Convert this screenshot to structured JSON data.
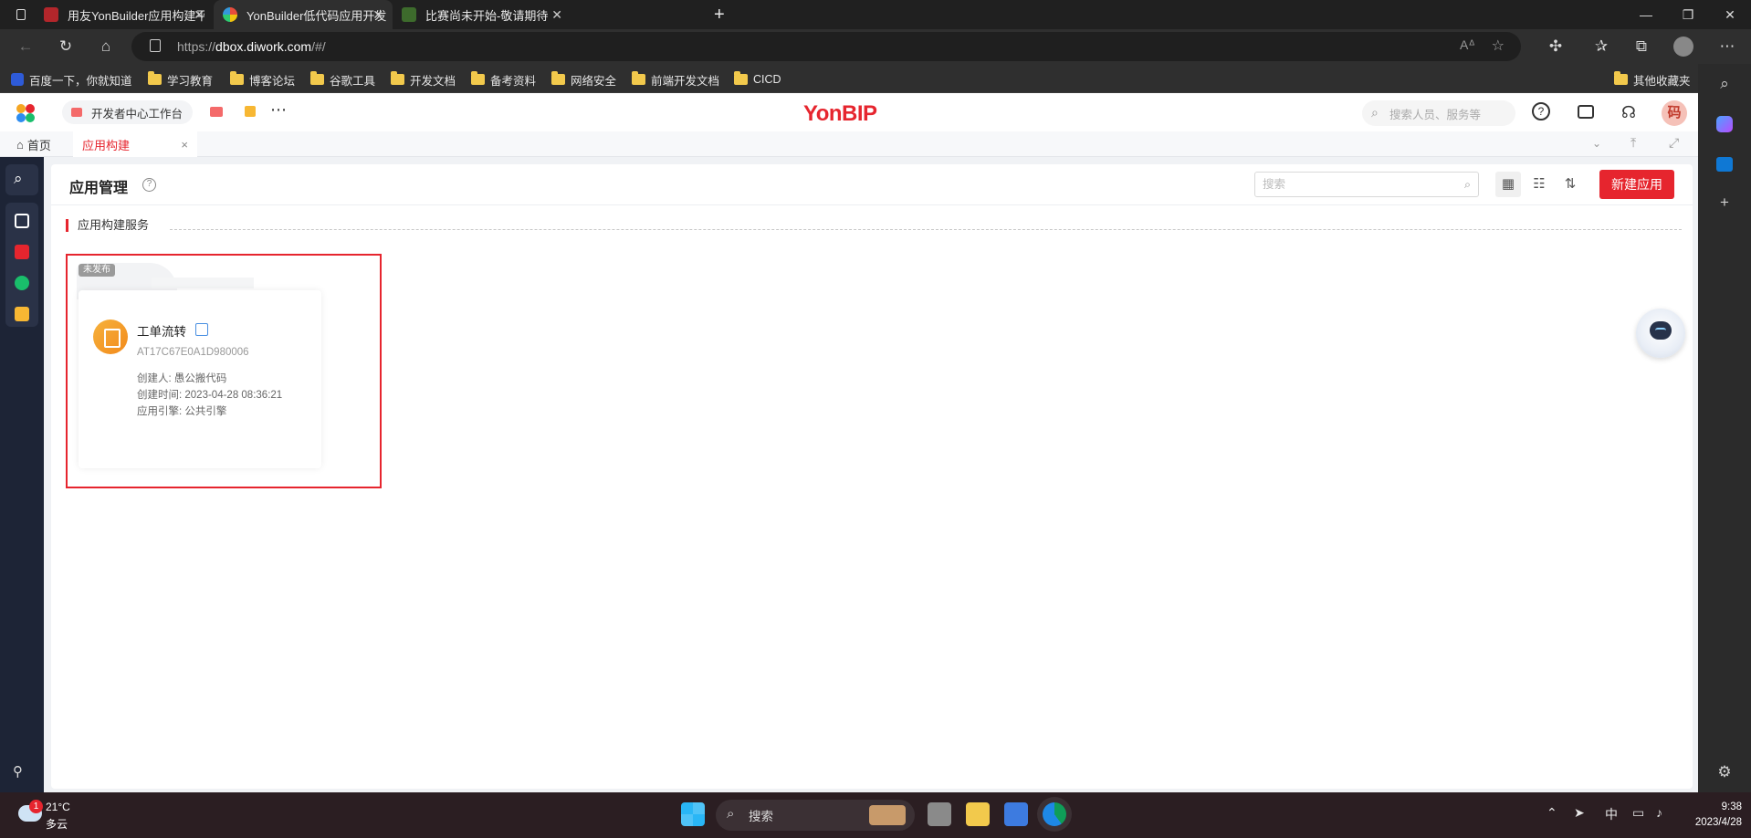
{
  "browser": {
    "tabs": [
      {
        "title": "用友YonBuilder应用构建平台-可",
        "active": false
      },
      {
        "title": "YonBuilder低代码应用开发",
        "active": true
      },
      {
        "title": "比赛尚未开始-敬请期待",
        "active": false
      }
    ],
    "url_prefix": "https://",
    "url_host": "dbox.diwork.com",
    "url_path": "/#/",
    "new_tab": "+"
  },
  "bookmarks": {
    "items": [
      "百度一下，你就知道",
      "学习教育",
      "博客论坛",
      "谷歌工具",
      "开发文档",
      "备考资料",
      "网络安全",
      "前端开发文档",
      "CICD"
    ],
    "other": "其他收藏夹"
  },
  "app_header": {
    "workbench_label": "开发者中心工作台",
    "brand": "YonBIP",
    "search_placeholder": "搜索人员、服务等",
    "avatar_text": "码"
  },
  "page_tabs": {
    "home": "首页",
    "current": "应用构建",
    "close": "×"
  },
  "content": {
    "title": "应用管理",
    "help": "?",
    "search_placeholder": "搜索",
    "new_app_button": "新建应用",
    "section_title": "应用构建服务"
  },
  "app_card": {
    "status_badge": "未发布",
    "name": "工单流转",
    "code": "AT17C67E0A1D980006",
    "creator": "创建人: 愚公搬代码",
    "created_time": "创建时间: 2023-04-28 08:36:21",
    "engine": "应用引擎: 公共引擎"
  },
  "taskbar": {
    "notification_count": "1",
    "temperature": "21°C",
    "weather": "多云",
    "search": "搜索",
    "ime": "中",
    "time": "9:38",
    "date": "2023/4/28"
  },
  "colors": {
    "accent": "#e6252e",
    "nav_bg": "#1d2436"
  }
}
